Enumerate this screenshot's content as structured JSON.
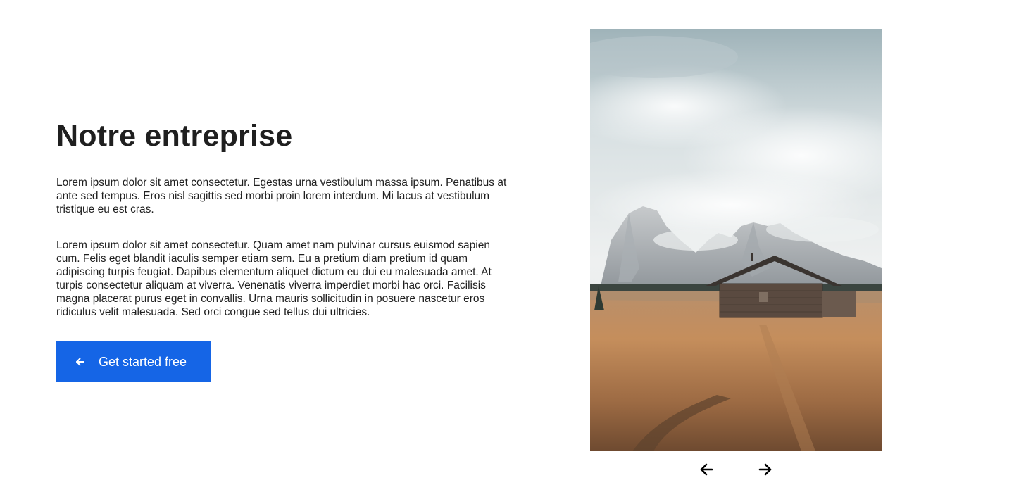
{
  "main": {
    "title": "Notre entreprise",
    "paragraphs": [
      "Lorem ipsum dolor sit amet consectetur. Egestas urna vestibulum massa ipsum. Penatibus at ante sed tempus. Eros nisl sagittis sed morbi proin lorem interdum. Mi lacus at vestibulum tristique eu est cras.",
      "Lorem ipsum dolor sit amet consectetur. Quam amet nam pulvinar cursus euismod sapien cum. Felis eget blandit iaculis semper etiam sem. Eu a pretium diam pretium id quam adipiscing turpis feugiat. Dapibus elementum aliquet dictum eu dui eu malesuada amet. At turpis consectetur aliquam at viverra. Venenatis viverra imperdiet morbi hac orci. Facilisis magna placerat purus eget in convallis. Urna mauris sollicitudin in posuere nascetur eros ridiculus velit malesuada. Sed orci congue sed tellus dui ultricies."
    ],
    "cta": {
      "label": "Get started free",
      "icon": "arrow-left-icon"
    }
  },
  "carousel": {
    "prev_icon": "arrow-left-icon",
    "next_icon": "arrow-right-icon"
  },
  "colors": {
    "accent": "#1565e6",
    "text": "#1f1f1f",
    "background": "#ffffff"
  }
}
